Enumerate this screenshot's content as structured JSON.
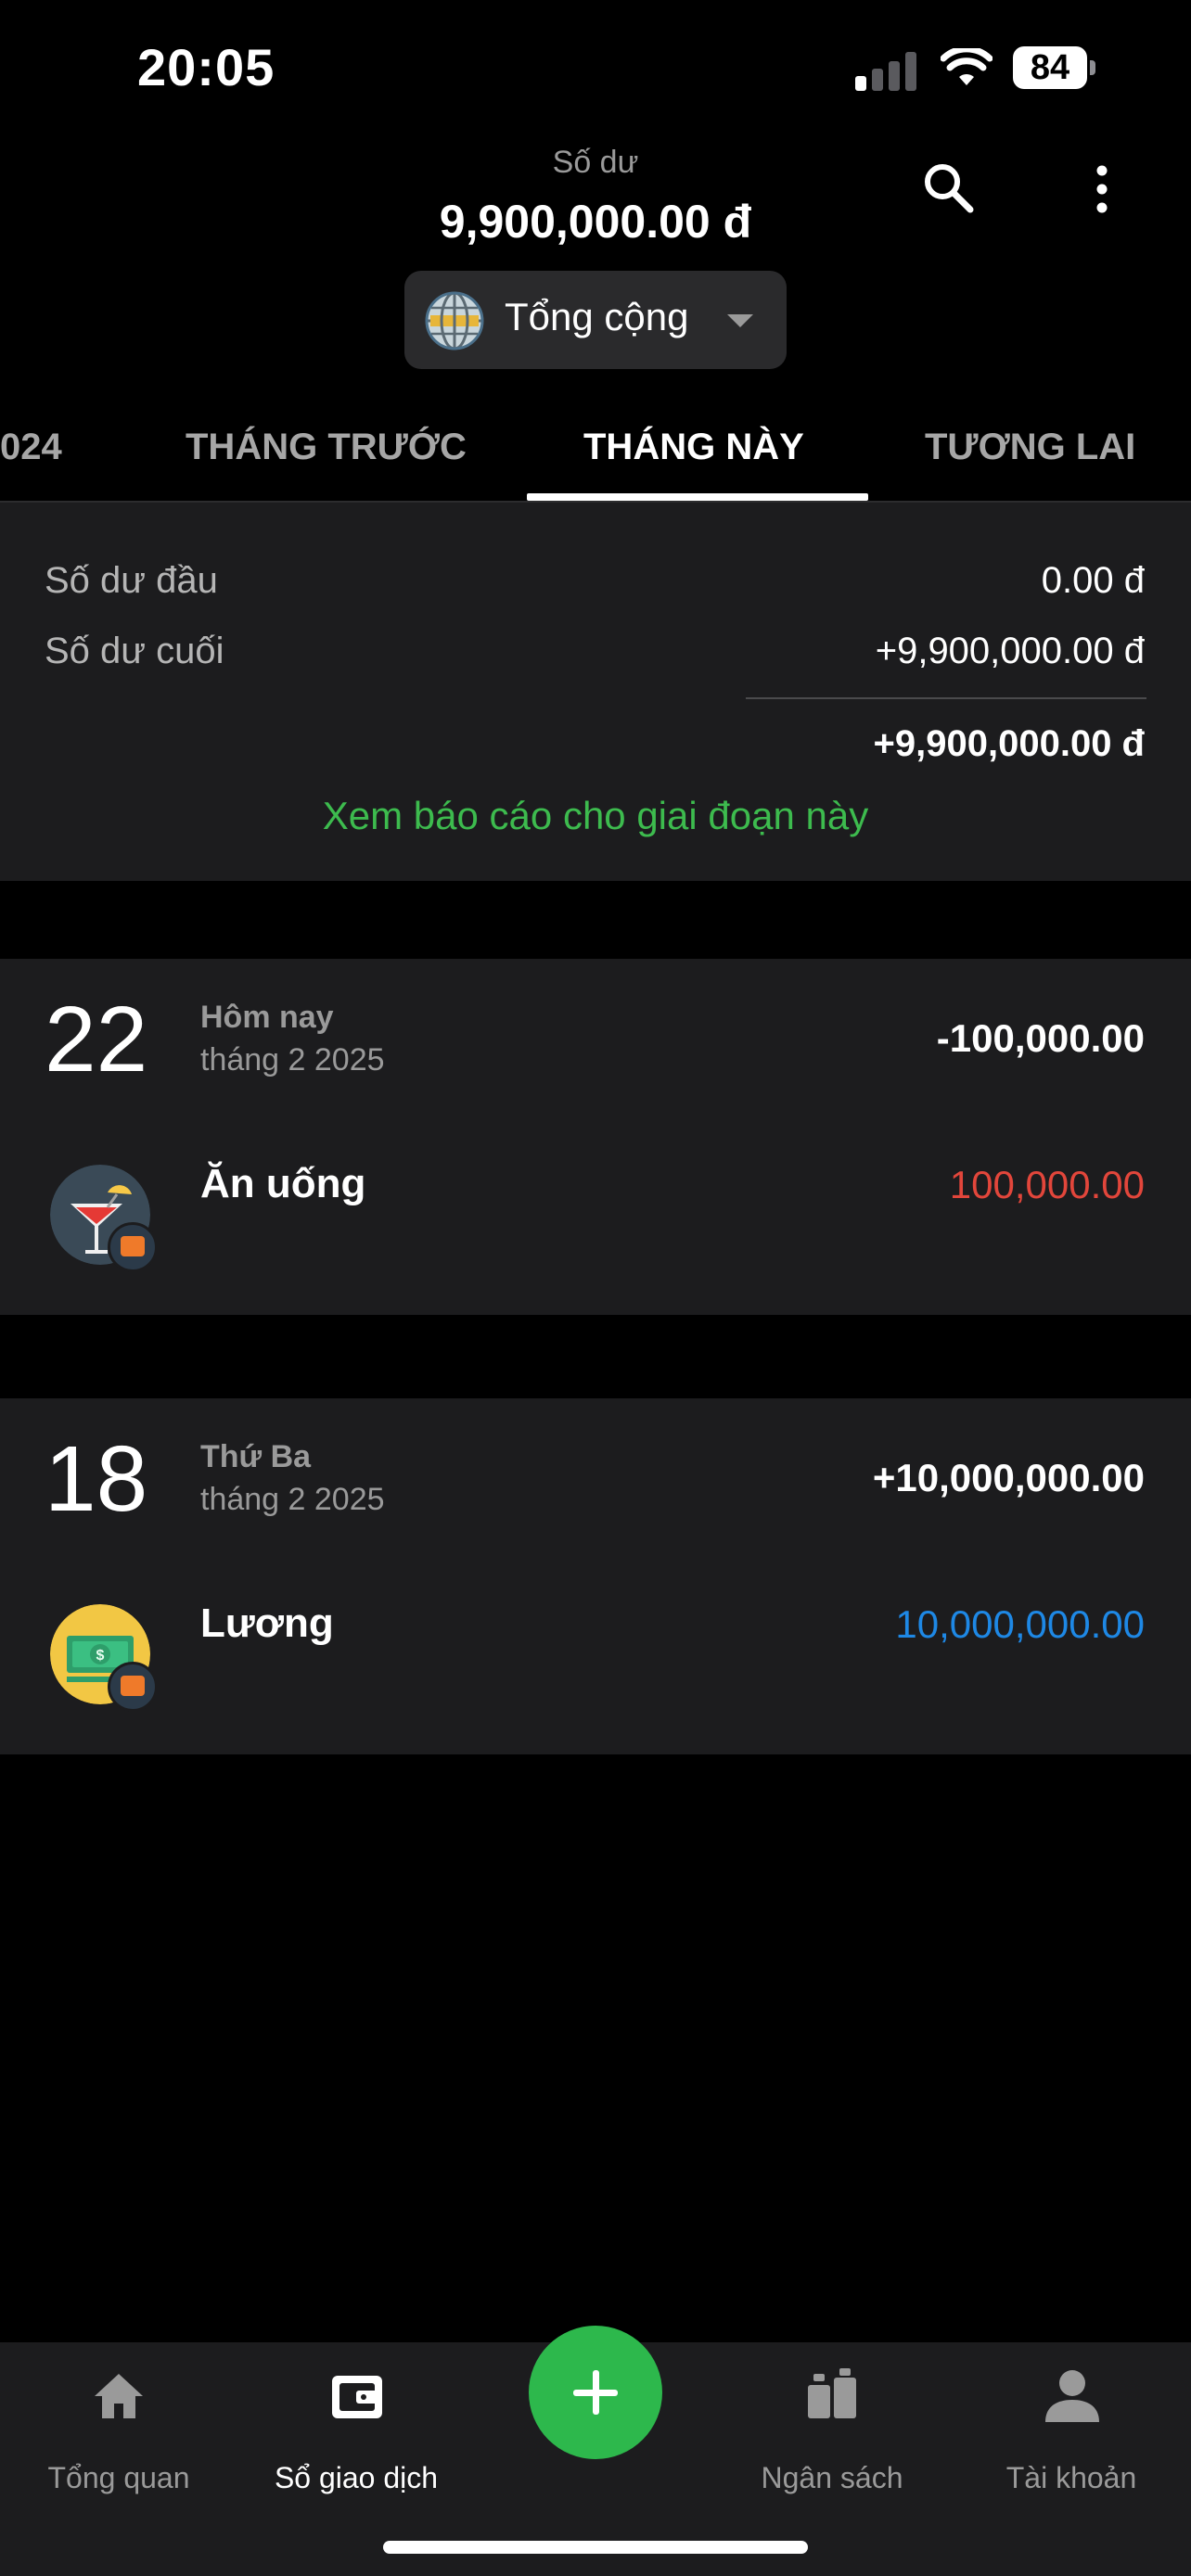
{
  "status_bar": {
    "time": "20:05",
    "battery": "84",
    "signal_bars_active": 1
  },
  "header": {
    "balance_label": "Số dư",
    "balance_value": "9,900,000.00 đ",
    "wallet_name": "Tổng cộng"
  },
  "tabs": [
    {
      "label": "024",
      "active": false
    },
    {
      "label": "THÁNG TRƯỚC",
      "active": false
    },
    {
      "label": "THÁNG NÀY",
      "active": true
    },
    {
      "label": "TƯƠNG LAI",
      "active": false
    }
  ],
  "summary": {
    "opening_label": "Số dư đầu",
    "opening_value": "0.00 đ",
    "closing_label": "Số dư cuối",
    "closing_value": "+9,900,000.00 đ",
    "net_value": "+9,900,000.00 đ",
    "report_link": "Xem báo cáo cho giai đoạn này"
  },
  "days": [
    {
      "day": "22",
      "weekday": "Hôm nay",
      "month": "tháng 2 2025",
      "total": "-100,000.00",
      "transactions": [
        {
          "category": "Ăn uống",
          "amount": "100,000.00",
          "type": "expense",
          "icon": "cocktail-icon"
        }
      ]
    },
    {
      "day": "18",
      "weekday": "Thứ Ba",
      "month": "tháng 2 2025",
      "total": "+10,000,000.00",
      "transactions": [
        {
          "category": "Lương",
          "amount": "10,000,000.00",
          "type": "income",
          "icon": "money-icon"
        }
      ]
    }
  ],
  "bottom_nav": [
    {
      "label": "Tổng quan",
      "icon": "home-icon",
      "active": false
    },
    {
      "label": "Sổ giao dịch",
      "icon": "wallet-icon",
      "active": true
    },
    {
      "label": "Ngân sách",
      "icon": "budget-icon",
      "active": false
    },
    {
      "label": "Tài khoản",
      "icon": "account-icon",
      "active": false
    }
  ],
  "colors": {
    "accent_green": "#2db84c",
    "link_green": "#3dbb4e",
    "expense_red": "#e2463b",
    "income_blue": "#1e88e5",
    "card_bg": "#1c1c1e"
  }
}
